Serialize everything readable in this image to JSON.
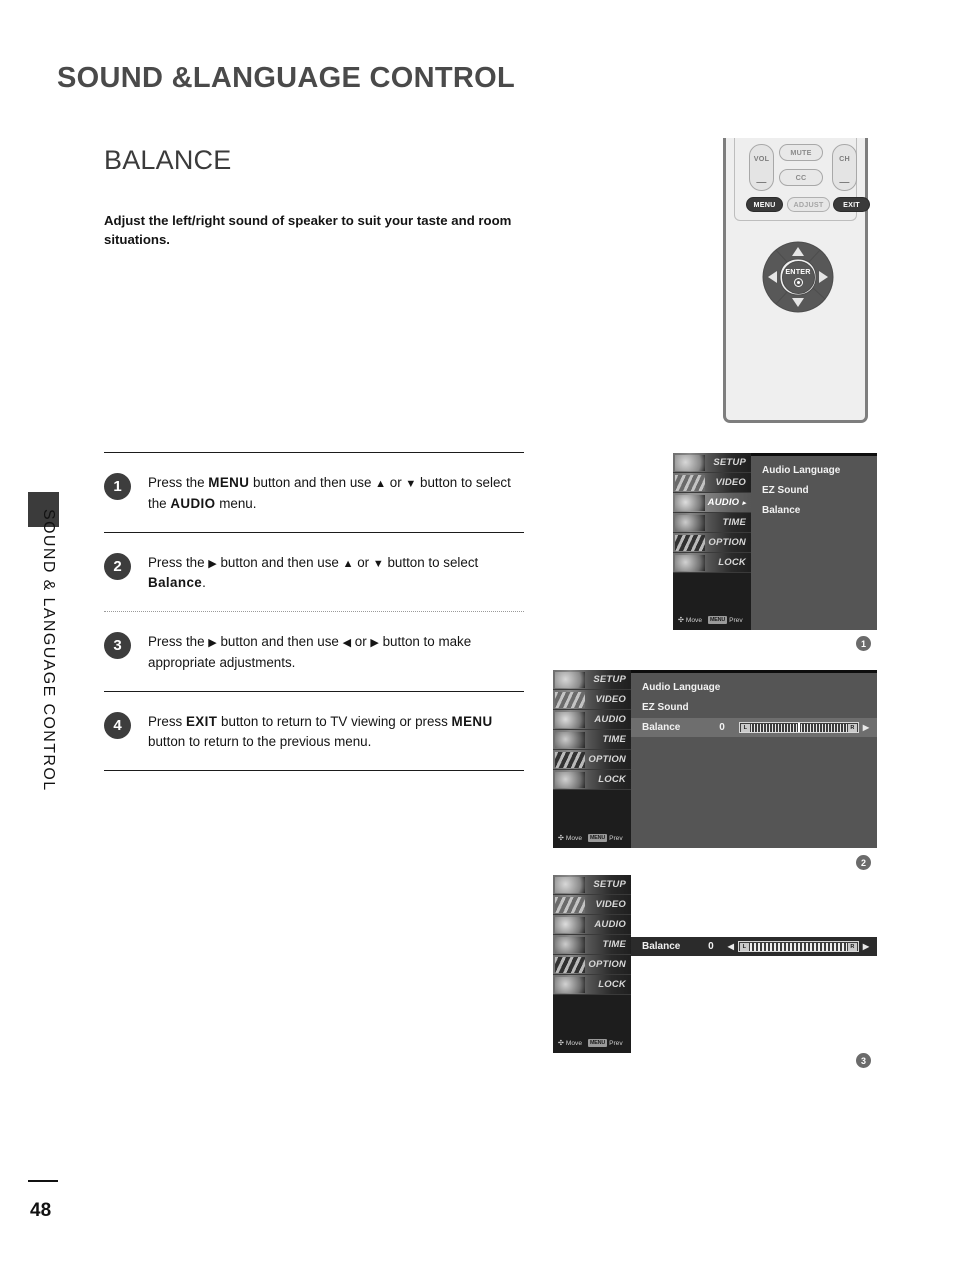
{
  "page": {
    "chapter_title": "SOUND &LANGUAGE CONTROL",
    "section_title": "BALANCE",
    "intro": "Adjust the left/right sound of speaker to suit your taste and room situations.",
    "side_tab_text": "SOUND & LANGUAGE CONTROL",
    "page_number": "48"
  },
  "steps": [
    {
      "num": "1",
      "parts": [
        {
          "t": "Press the ",
          "b": false
        },
        {
          "t": "MENU",
          "b": true
        },
        {
          "t": " button and then use ",
          "b": false
        },
        {
          "t": "▲",
          "b": false
        },
        {
          "t": " or ",
          "b": false
        },
        {
          "t": "▼",
          "b": false
        },
        {
          "t": " button to select the ",
          "b": false
        },
        {
          "t": "AUDIO",
          "b": true
        },
        {
          "t": " menu.",
          "b": false
        }
      ]
    },
    {
      "num": "2",
      "parts": [
        {
          "t": "Press the ",
          "b": false
        },
        {
          "t": "▶",
          "b": false
        },
        {
          "t": " button and then use ",
          "b": false
        },
        {
          "t": "▲",
          "b": false
        },
        {
          "t": " or ",
          "b": false
        },
        {
          "t": "▼",
          "b": false
        },
        {
          "t": " button to select ",
          "b": false
        },
        {
          "t": "Balance",
          "b": true
        },
        {
          "t": ".",
          "b": false
        }
      ]
    },
    {
      "num": "3",
      "parts": [
        {
          "t": "Press the ",
          "b": false
        },
        {
          "t": "▶",
          "b": false
        },
        {
          "t": " button and then use ",
          "b": false
        },
        {
          "t": "◀",
          "b": false
        },
        {
          "t": " or ",
          "b": false
        },
        {
          "t": "▶",
          "b": false
        },
        {
          "t": " button to make appropriate adjustments.",
          "b": false
        }
      ]
    },
    {
      "num": "4",
      "parts": [
        {
          "t": "Press ",
          "b": false
        },
        {
          "t": "EXIT",
          "b": true
        },
        {
          "t": " button to return to TV viewing or press ",
          "b": false
        },
        {
          "t": "MENU",
          "b": true
        },
        {
          "t": " button to return to the previous menu.",
          "b": false
        }
      ]
    }
  ],
  "remote": {
    "vol_label": "VOL",
    "vol_minus": "—",
    "ch_label": "CH",
    "ch_minus": "—",
    "mute_label": "MUTE",
    "cc_label": "CC",
    "menu_label": "MENU",
    "adjust_label": "ADJUST",
    "exit_label": "EXIT",
    "enter_label": "ENTER"
  },
  "osd": {
    "sidebar_items": [
      "SETUP",
      "VIDEO",
      "AUDIO",
      "TIME",
      "OPTION",
      "LOCK"
    ],
    "cursor_glyph": "▸",
    "status_move": "Move",
    "status_prev": "Prev",
    "status_prev_chip": "MENU",
    "menu_items": [
      "Audio Language",
      "EZ Sound",
      "Balance"
    ],
    "balance_label": "Balance",
    "balance_value": "0",
    "slider_left_cap": "L",
    "slider_right_cap": "R",
    "left_arrow": "◀",
    "right_arrow": "▶"
  },
  "markers": [
    "1",
    "2",
    "3"
  ],
  "colors": {
    "osd_bg": "#555555",
    "osd_sidebar": "#1d1d1d",
    "osd_selected_row": "#6e6e6e",
    "step_circle": "#3d3d3d",
    "marker": "#6b6b6b",
    "title_gray": "#4a4a4a"
  }
}
